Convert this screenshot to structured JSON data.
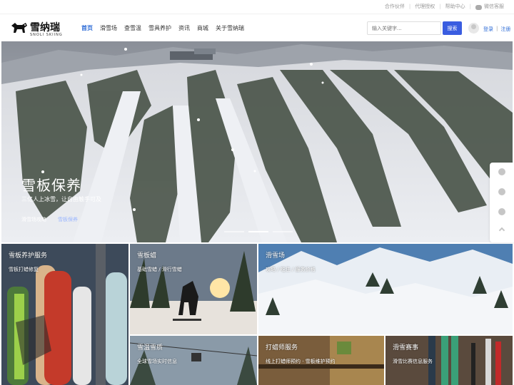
{
  "util": {
    "links": [
      "合作伙伴",
      "代理授权",
      "帮助中心",
      "微信客服"
    ]
  },
  "header": {
    "logo_cn": "雪纳瑞",
    "logo_en": "SNOLI SKIING",
    "nav": [
      "首页",
      "滑雪场",
      "查雪温",
      "雪具养护",
      "资讯",
      "商城",
      "关于雪纳瑞"
    ],
    "search_placeholder": "输入关键字...",
    "search_button": "搜索",
    "login": "登录",
    "register": "注册"
  },
  "hero": {
    "title": "雪板保养",
    "subtitle": "三亿人上冰雪，让自由触手可及",
    "tags": [
      "滑雪场攻略",
      "雪板保养"
    ]
  },
  "cards": [
    {
      "title": "雪板养护服务",
      "subtitle": "雪板打蜡修复"
    },
    {
      "title": "雪板蜡",
      "subtitle": "基础雪蜡 / 滑行雪蜡"
    },
    {
      "title": "滑雪场",
      "subtitle": "攻略 / 吃住 / 服务价格"
    },
    {
      "title": "雪温雪质",
      "subtitle": "全球雪场实时信息"
    },
    {
      "title": "打蜡师服务",
      "subtitle": "线上打蜡师预约 · 雪板维护预约"
    },
    {
      "title": "滑雪赛事",
      "subtitle": "滑雪比赛信息服务"
    }
  ],
  "colors": {
    "accent": "#2d6bd6",
    "search_button": "#3a5de0"
  },
  "icons": [
    "wechat-icon",
    "user-avatar-icon",
    "help-icon",
    "message-icon",
    "chat-icon",
    "back-to-top-icon"
  ]
}
